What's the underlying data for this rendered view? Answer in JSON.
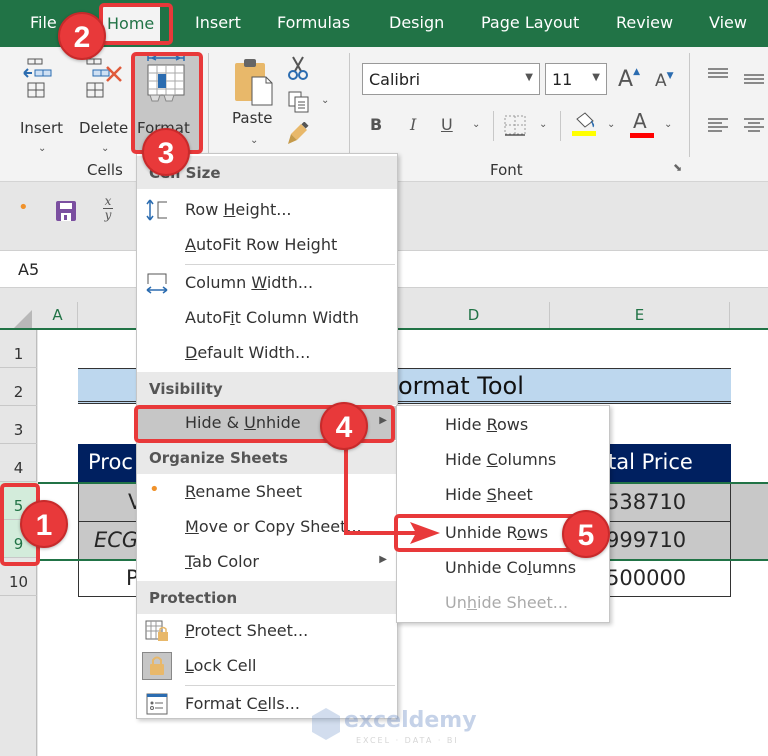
{
  "ribbon_tabs": [
    "File",
    "Home",
    "Insert",
    "Formulas",
    "Design",
    "Page Layout",
    "Review",
    "View"
  ],
  "active_tab": "Home",
  "cells_group": {
    "label": "Cells",
    "buttons": [
      "Insert",
      "Delete",
      "Format"
    ]
  },
  "clipboard_group": {
    "paste_label": "Paste"
  },
  "font_group": {
    "label": "Font",
    "font_name": "Calibri",
    "font_size": "11",
    "bold": "B",
    "italic": "I",
    "underline": "U",
    "font_color_label": "A",
    "grow_label": "A",
    "shrink_label": "A",
    "highlight_color": "#ffff00",
    "font_color": "#ff0000"
  },
  "qat": {
    "fraction_top": "x",
    "fraction_bottom": "y"
  },
  "name_box": "A5",
  "columns": [
    "A",
    "D",
    "E"
  ],
  "rows": [
    "1",
    "2",
    "3",
    "4",
    "5",
    "9",
    "10"
  ],
  "sheet": {
    "title": "ormat Tool",
    "header_left": "Proc",
    "header_right": "tal Price",
    "row5_left": "V",
    "row5_right": "538710",
    "row9_left": "ECG",
    "row9_right": "999710",
    "row10_left": "P",
    "row10_right": "500000"
  },
  "format_menu": {
    "sections": [
      {
        "heading": "Cell Size",
        "items": [
          {
            "label_pre": "Row ",
            "label_u": "H",
            "label_post": "eight...",
            "icon": "row-height-icon"
          },
          {
            "label_pre": "",
            "label_u": "A",
            "label_post": "utoFit Row Height",
            "icon": ""
          },
          {
            "label_pre": "Column ",
            "label_u": "W",
            "label_post": "idth...",
            "icon": "column-width-icon"
          },
          {
            "label_pre": "AutoF",
            "label_u": "i",
            "label_post": "t Column Width",
            "icon": ""
          },
          {
            "label_pre": "",
            "label_u": "D",
            "label_post": "efault Width...",
            "icon": ""
          }
        ]
      },
      {
        "heading": "Visibility",
        "items": [
          {
            "label_pre": "Hide & ",
            "label_u": "U",
            "label_post": "nhide",
            "icon": "",
            "submenu": true,
            "highlighted": true
          }
        ]
      },
      {
        "heading": "Organize Sheets",
        "items": [
          {
            "label_pre": "",
            "label_u": "R",
            "label_post": "ename Sheet",
            "icon": "bullet-icon"
          },
          {
            "label_pre": "",
            "label_u": "M",
            "label_post": "ove or Copy Sheet...",
            "icon": ""
          },
          {
            "label_pre": "",
            "label_u": "T",
            "label_post": "ab Color",
            "icon": "",
            "submenu": true
          }
        ]
      },
      {
        "heading": "Protection",
        "items": [
          {
            "label_pre": "",
            "label_u": "P",
            "label_post": "rotect Sheet...",
            "icon": "protect-sheet-icon"
          },
          {
            "label_pre": "",
            "label_u": "L",
            "label_post": "ock Cell",
            "icon": "lock-icon"
          },
          {
            "label_pre": "Format C",
            "label_u": "e",
            "label_post": "lls...",
            "icon": "format-cells-icon"
          }
        ]
      }
    ]
  },
  "hide_unhide_submenu": [
    {
      "label_pre": "Hide ",
      "label_u": "R",
      "label_post": "ows",
      "disabled": false
    },
    {
      "label_pre": "Hide ",
      "label_u": "C",
      "label_post": "olumns",
      "disabled": false
    },
    {
      "label_pre": "Hide ",
      "label_u": "S",
      "label_post": "heet",
      "disabled": false
    },
    {
      "label_pre": "Unhide R",
      "label_u": "o",
      "label_post": "ws",
      "disabled": false
    },
    {
      "label_pre": "Unhide Co",
      "label_u": "l",
      "label_post": "umns",
      "disabled": false
    },
    {
      "label_pre": "Un",
      "label_u": "h",
      "label_post": "ide Sheet...",
      "disabled": true
    }
  ],
  "annotations": [
    "1",
    "2",
    "3",
    "4",
    "5"
  ],
  "watermark": {
    "brand": "exceldemy",
    "tagline": "EXCEL · DATA · BI"
  },
  "colors": {
    "excel_green": "#217346",
    "annotation_red": "#e8393a",
    "table_header_bg": "#002060",
    "title_bg": "#bdd7ee",
    "hidden_row_bg": "#c8c8c8"
  }
}
